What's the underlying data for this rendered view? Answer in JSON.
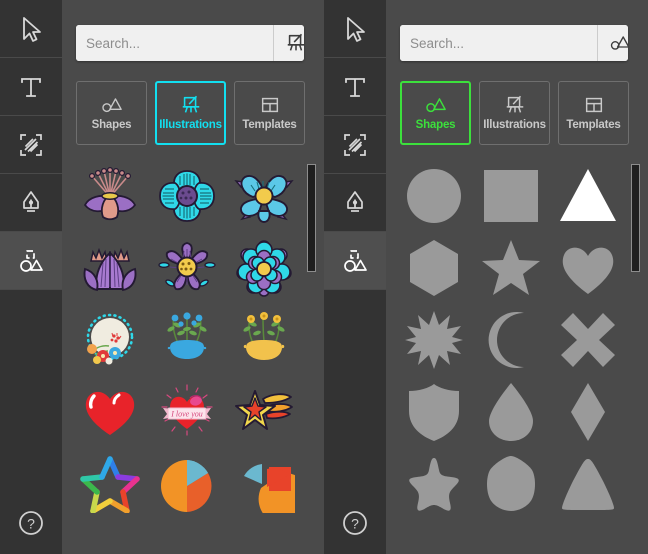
{
  "panels": [
    {
      "id": "illustrations-panel",
      "accent": "#12dff0",
      "search": {
        "value": "",
        "placeholder": "Search...",
        "icon": "easel-illustration-icon",
        "dropdown": "chevron-down-icon"
      },
      "tabs": [
        {
          "label": "Shapes",
          "icon": "shapes-icon",
          "selected": false
        },
        {
          "label": "Illustrations",
          "icon": "easel-illustration-icon",
          "selected": true
        },
        {
          "label": "Templates",
          "icon": "templates-grid-icon",
          "selected": false
        }
      ],
      "tools": [
        {
          "name": "select-arrow-tool",
          "active": false
        },
        {
          "name": "text-tool",
          "active": false
        },
        {
          "name": "image-tool",
          "active": false
        },
        {
          "name": "pen-tool",
          "active": false
        },
        {
          "name": "shapes-tool",
          "active": true
        }
      ],
      "help": {
        "icon": "help-question-icon",
        "label": "?"
      },
      "items": [
        {
          "name": "flower-purple-fan",
          "row": 1,
          "col": 1
        },
        {
          "name": "flower-cyan-4petal",
          "row": 1,
          "col": 2
        },
        {
          "name": "flower-cyan-5petal",
          "row": 1,
          "col": 3
        },
        {
          "name": "flower-purple-lotus",
          "row": 2,
          "col": 1
        },
        {
          "name": "flower-purple-5petal",
          "row": 2,
          "col": 2
        },
        {
          "name": "flower-cyan-layered",
          "row": 2,
          "col": 3
        },
        {
          "name": "floral-round-frame",
          "row": 3,
          "col": 1
        },
        {
          "name": "floral-blue-badge",
          "row": 3,
          "col": 2
        },
        {
          "name": "floral-yellow-badge",
          "row": 3,
          "col": 3
        },
        {
          "name": "red-heart",
          "row": 4,
          "col": 1
        },
        {
          "name": "heart-love-banner",
          "row": 4,
          "col": 2,
          "text": "I love you"
        },
        {
          "name": "shooting-star",
          "row": 4,
          "col": 3
        },
        {
          "name": "rainbow-outline-star",
          "row": 5,
          "col": 1
        },
        {
          "name": "pie-chart-three-slice",
          "row": 5,
          "col": 2
        },
        {
          "name": "pie-chart-exploded",
          "row": 5,
          "col": 3
        }
      ]
    },
    {
      "id": "shapes-panel",
      "accent": "#3ce03c",
      "search": {
        "value": "",
        "placeholder": "Search...",
        "icon": "shapes-icon",
        "dropdown": "chevron-down-icon"
      },
      "tabs": [
        {
          "label": "Shapes",
          "icon": "shapes-icon",
          "selected": true
        },
        {
          "label": "Illustrations",
          "icon": "easel-illustration-icon",
          "selected": false
        },
        {
          "label": "Templates",
          "icon": "templates-grid-icon",
          "selected": false
        }
      ],
      "tools": [
        {
          "name": "select-arrow-tool",
          "active": false
        },
        {
          "name": "text-tool",
          "active": false
        },
        {
          "name": "image-tool",
          "active": false
        },
        {
          "name": "pen-tool",
          "active": false
        },
        {
          "name": "shapes-tool",
          "active": true
        }
      ],
      "help": {
        "icon": "help-question-icon",
        "label": "?"
      },
      "items": [
        {
          "name": "shape-circle",
          "row": 1,
          "col": 1,
          "highlighted": false
        },
        {
          "name": "shape-square",
          "row": 1,
          "col": 2,
          "highlighted": false
        },
        {
          "name": "shape-triangle",
          "row": 1,
          "col": 3,
          "highlighted": true
        },
        {
          "name": "shape-hexagon",
          "row": 2,
          "col": 1,
          "highlighted": false
        },
        {
          "name": "shape-star-5",
          "row": 2,
          "col": 2,
          "highlighted": false
        },
        {
          "name": "shape-heart",
          "row": 2,
          "col": 3,
          "highlighted": false
        },
        {
          "name": "shape-starburst-12",
          "row": 3,
          "col": 1,
          "highlighted": false
        },
        {
          "name": "shape-crescent-moon",
          "row": 3,
          "col": 2,
          "highlighted": false
        },
        {
          "name": "shape-cross-x",
          "row": 3,
          "col": 3,
          "highlighted": false
        },
        {
          "name": "shape-shield",
          "row": 4,
          "col": 1,
          "highlighted": false
        },
        {
          "name": "shape-teardrop",
          "row": 4,
          "col": 2,
          "highlighted": false
        },
        {
          "name": "shape-rhombus",
          "row": 4,
          "col": 3,
          "highlighted": false
        },
        {
          "name": "shape-star-rounded",
          "row": 5,
          "col": 1,
          "highlighted": false
        },
        {
          "name": "shape-heptagon",
          "row": 5,
          "col": 2,
          "highlighted": false
        },
        {
          "name": "shape-triangle-rounded",
          "row": 5,
          "col": 3,
          "highlighted": false
        }
      ]
    }
  ],
  "colors": {
    "background": "#4a4a4a",
    "rail": "#333333",
    "rail_active": "#4f4f4f",
    "tab_border": "#6f6f6f",
    "tab_text": "#c9c9c9",
    "accent_cyan": "#12dff0",
    "accent_green": "#3ce03c",
    "shape_fill": "#9a9a9a",
    "shape_fill_highlight": "#ffffff",
    "scrollbar_thumb": "#1f1f1f"
  }
}
